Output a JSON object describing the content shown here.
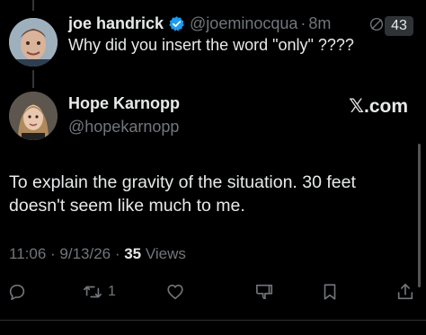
{
  "reply": {
    "name": "joe handrick",
    "handle": "@joeminocqua",
    "separator": "·",
    "time": "8m",
    "badge_count": "43",
    "text": "Why did you insert the word \"only\" ????"
  },
  "post": {
    "name": "Hope Karnopp",
    "handle": "@hopekarnopp",
    "brand": "𝕏.com",
    "text": "To explain the gravity of the situation. 30 feet doesn't seem like much to me.",
    "timestamp": "11:06 · 9/13/26 · ",
    "views_count": "35",
    "views_label": " Views"
  },
  "actions": {
    "reply_icon": "comment-icon",
    "retweet_icon": "retweet-icon",
    "retweet_count": "1",
    "like_icon": "heart-icon",
    "dislike_icon": "thumbs-down-icon",
    "bookmark_icon": "bookmark-icon",
    "share_icon": "share-icon"
  },
  "colors": {
    "background": "#000000",
    "text": "#e7e9ea",
    "secondary": "#71767b",
    "verified": "#1d9bf0"
  }
}
